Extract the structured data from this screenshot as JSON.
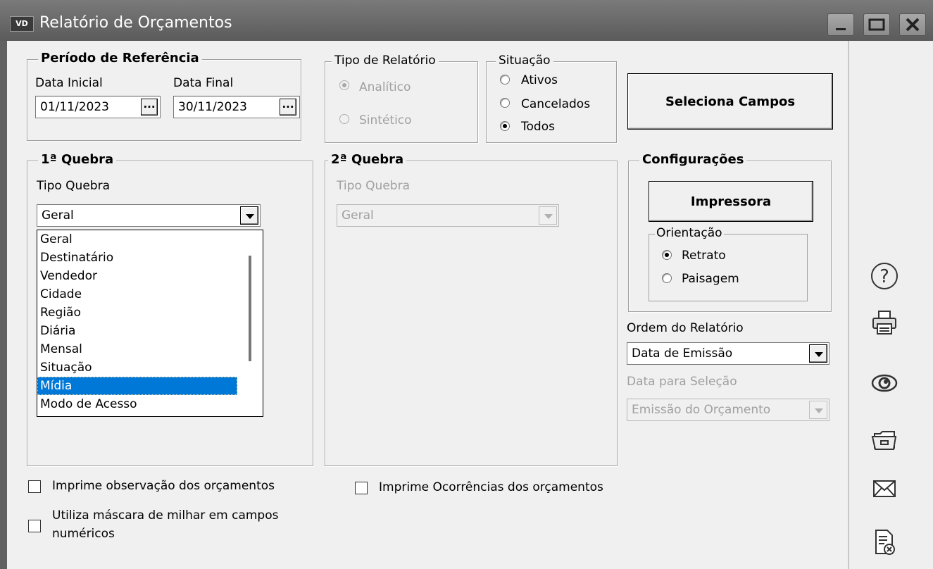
{
  "window": {
    "title": "Relatório de Orçamentos",
    "app_icon_text": "VD"
  },
  "periodo": {
    "legend": "Período de Referência",
    "data_inicial_label": "Data Inicial",
    "data_inicial_value": "01/11/2023",
    "data_final_label": "Data Final",
    "data_final_value": "30/11/2023",
    "picker_label": "..."
  },
  "tipo_relatorio": {
    "legend": "Tipo de Relatório",
    "options": [
      "Analítico",
      "Sintético"
    ],
    "selected": "Analítico",
    "enabled": false
  },
  "situacao": {
    "legend": "Situação",
    "options": [
      "Ativos",
      "Cancelados",
      "Todos"
    ],
    "selected": "Todos"
  },
  "seleciona_campos_label": "Seleciona Campos",
  "quebra1": {
    "legend": "1ª Quebra",
    "tipo_label": "Tipo Quebra",
    "value": "Geral",
    "options": [
      "Geral",
      "Destinatário",
      "Vendedor",
      "Cidade",
      "Região",
      "Diária",
      "Mensal",
      "Situação",
      "Mídia",
      "Modo de Acesso"
    ],
    "highlighted": "Mídia"
  },
  "quebra2": {
    "legend": "2ª Quebra",
    "tipo_label": "Tipo Quebra",
    "value": "Geral",
    "enabled": false
  },
  "configuracoes": {
    "legend": "Configurações",
    "impressora_label": "Impressora",
    "orientacao_legend": "Orientação",
    "orientacao_options": [
      "Retrato",
      "Paisagem"
    ],
    "orientacao_selected": "Retrato"
  },
  "ordem": {
    "label": "Ordem do Relatório",
    "value": "Data de Emissão"
  },
  "data_selecao": {
    "label": "Data para Seleção",
    "value": "Emissão do Orçamento",
    "enabled": false
  },
  "checks": {
    "observacao": "Imprime observação dos orçamentos",
    "observacao_checked": false,
    "mascara_line1": "Utiliza máscara de milhar em campos",
    "mascara_line2": "numéricos",
    "mascara_checked": false,
    "ocorrencias": "Imprime Ocorrências dos orçamentos",
    "ocorrencias_checked": false
  },
  "side_icons": [
    "help-icon",
    "print-icon",
    "preview-icon",
    "folder-icon",
    "email-icon",
    "cancel-document-icon"
  ]
}
